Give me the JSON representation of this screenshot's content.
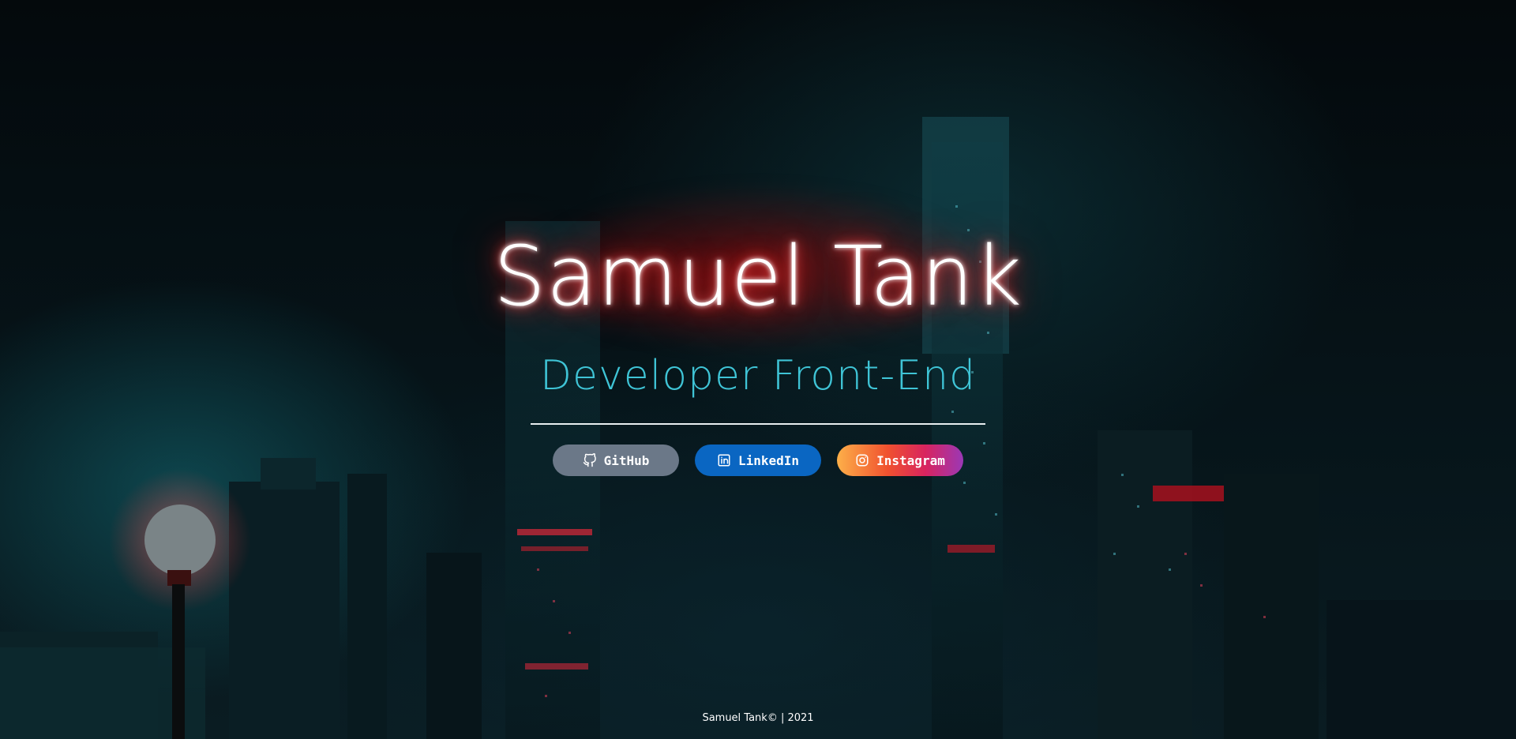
{
  "hero": {
    "name": "Samuel Tank",
    "role": "Developer Front-End"
  },
  "socials": [
    {
      "label": "GitHub",
      "icon": "github-icon",
      "color": "#6b7888"
    },
    {
      "label": "LinkedIn",
      "icon": "linkedin-icon",
      "color": "#0a66c2"
    },
    {
      "label": "Instagram",
      "icon": "instagram-icon",
      "color": "#e1306c"
    }
  ],
  "footer": {
    "text": "Samuel Tank© | 2021"
  },
  "colors": {
    "title_glow": "#ff2020",
    "subtitle": "#3fc4d6",
    "background": "#03090c"
  }
}
